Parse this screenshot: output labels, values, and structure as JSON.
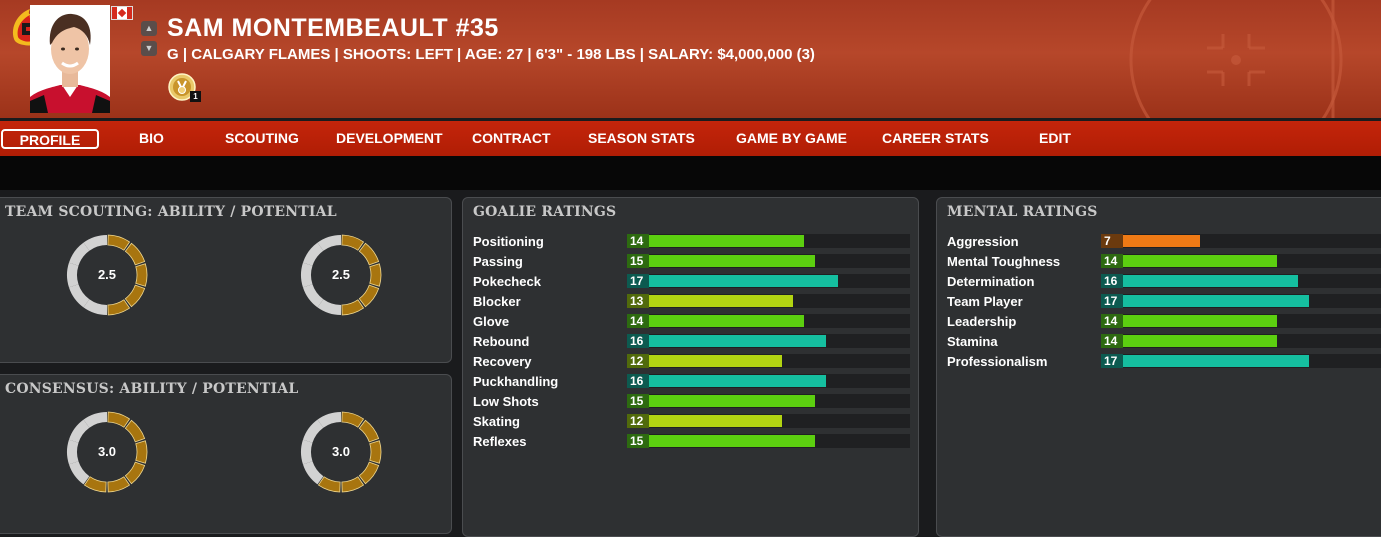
{
  "header": {
    "player_name": "SAM MONTEMBEAULT #35",
    "player_info": "G | CALGARY FLAMES | SHOOTS: LEFT | AGE: 27 | 6'3\" - 198 LBS | SALARY: $4,000,000 (3)",
    "medal_count": "1",
    "up_arrow": "▲",
    "down_arrow": "▼",
    "flag_icon": "canada-flag-icon",
    "team_logo_icon": "calgary-flames-logo-icon"
  },
  "nav": {
    "tabs": [
      {
        "label": "PROFILE",
        "active": true
      },
      {
        "label": "BIO"
      },
      {
        "label": "SCOUTING"
      },
      {
        "label": "DEVELOPMENT"
      },
      {
        "label": "CONTRACT"
      },
      {
        "label": "SEASON STATS"
      },
      {
        "label": "GAME BY GAME"
      },
      {
        "label": "CAREER STATS"
      },
      {
        "label": "EDIT"
      }
    ]
  },
  "team_scouting": {
    "title": "TEAM SCOUTING: ABILITY / POTENTIAL",
    "ability": "2.5",
    "potential": "2.5",
    "ability_stars": 2.5,
    "potential_stars": 2.5
  },
  "consensus": {
    "title": "CONSENSUS: ABILITY / POTENTIAL",
    "ability": "3.0",
    "potential": "3.0",
    "ability_stars": 3.0,
    "potential_stars": 3.0
  },
  "goalie_ratings": {
    "title": "GOALIE RATINGS",
    "items": [
      {
        "label": "Positioning",
        "value": "14"
      },
      {
        "label": "Passing",
        "value": "15"
      },
      {
        "label": "Pokecheck",
        "value": "17"
      },
      {
        "label": "Blocker",
        "value": "13"
      },
      {
        "label": "Glove",
        "value": "14"
      },
      {
        "label": "Rebound",
        "value": "16"
      },
      {
        "label": "Recovery",
        "value": "12"
      },
      {
        "label": "Puckhandling",
        "value": "16"
      },
      {
        "label": "Low Shots",
        "value": "15"
      },
      {
        "label": "Skating",
        "value": "12"
      },
      {
        "label": "Reflexes",
        "value": "15"
      }
    ]
  },
  "mental_ratings": {
    "title": "MENTAL RATINGS",
    "items": [
      {
        "label": "Aggression",
        "value": "7"
      },
      {
        "label": "Mental Toughness",
        "value": "14"
      },
      {
        "label": "Determination",
        "value": "16"
      },
      {
        "label": "Team Player",
        "value": "17"
      },
      {
        "label": "Leadership",
        "value": "14"
      },
      {
        "label": "Stamina",
        "value": "14"
      },
      {
        "label": "Professionalism",
        "value": "17"
      }
    ]
  },
  "colors": {
    "ring_gold": "#a8750f",
    "ring_grey": "#d2d2d2",
    "rating_orange": "#ef7a15",
    "rating_yellowgreen": "#b2d412",
    "rating_green": "#5ccf10",
    "rating_teal": "#15bfa0"
  }
}
